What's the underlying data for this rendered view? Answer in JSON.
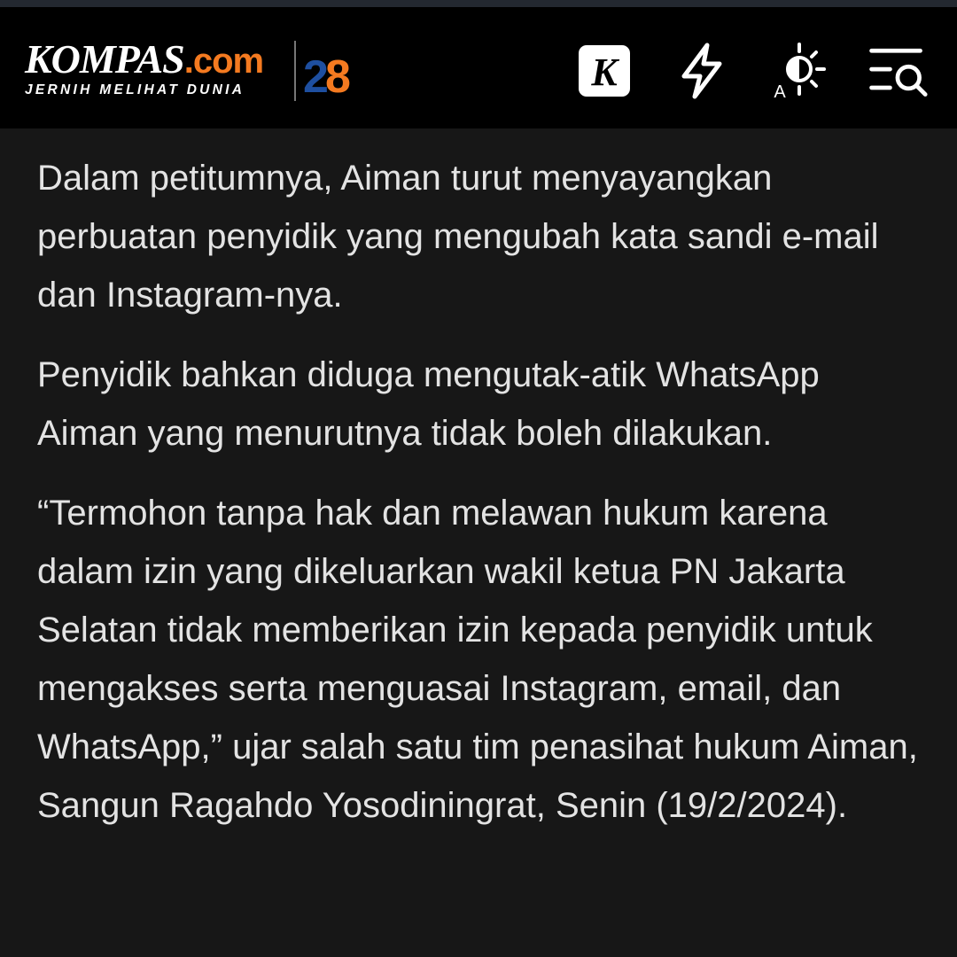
{
  "header": {
    "logo": {
      "wordmark": "KOMPAS",
      "wordmark_suffix": ".com",
      "tagline": "JERNIH MELIHAT DUNIA",
      "anniversary": "28"
    },
    "actions": [
      {
        "name": "kompas-k-icon",
        "label": "K"
      },
      {
        "name": "lightning-icon"
      },
      {
        "name": "display-mode-icon",
        "label": "A"
      },
      {
        "name": "menu-search-icon"
      }
    ]
  },
  "colors": {
    "header_bg": "#000000",
    "page_bg": "#171717",
    "text": "#e3e3e3",
    "brand_orange": "#f47a20",
    "brand_blue": "#1e4fa0"
  },
  "article": {
    "paragraphs": [
      "Dalam petitumnya, Aiman turut menyayangkan perbuatan penyidik yang mengubah kata sandi e-mail dan Instagram-nya.",
      "Penyidik bahkan diduga mengutak-atik WhatsApp Aiman yang menurutnya tidak boleh dilakukan.",
      "“Termohon tanpa hak dan melawan hukum karena dalam izin yang dikeluarkan wakil ketua PN Jakarta Selatan tidak memberikan izin kepada penyidik untuk mengakses serta menguasai Instagram, email, dan WhatsApp,” ujar salah satu tim penasihat hukum Aiman, Sangun Ragahdo Yosodiningrat, Senin (19/2/2024)."
    ]
  }
}
